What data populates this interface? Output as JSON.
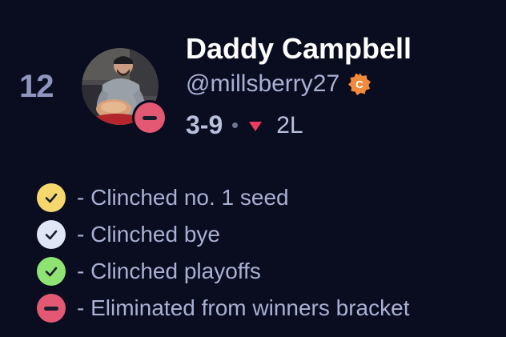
{
  "team": {
    "rank": "12",
    "name": "Daddy Campbell",
    "handle": "@millsberry27",
    "commissioner_badge_letter": "C",
    "record": "3-9",
    "streak": "2L",
    "streak_direction": "down",
    "status_icon": "eliminated-icon"
  },
  "legend": {
    "items": [
      {
        "icon": "check-icon",
        "color": "#f5d76e",
        "label": "- Clinched no. 1 seed"
      },
      {
        "icon": "check-icon",
        "color": "#dfe6f5",
        "label": "- Clinched bye"
      },
      {
        "icon": "check-icon",
        "color": "#8fe373",
        "label": "- Clinched playoffs"
      },
      {
        "icon": "minus-icon",
        "color": "#e35873",
        "label": "- Eliminated from winners bracket"
      }
    ]
  },
  "colors": {
    "background": "#0a0c1f",
    "name": "#ffffff",
    "muted": "#a9b1d3",
    "rank": "#8e96be",
    "loss_arrow": "#f03a5f",
    "commissioner_badge": "#f28a3c"
  }
}
